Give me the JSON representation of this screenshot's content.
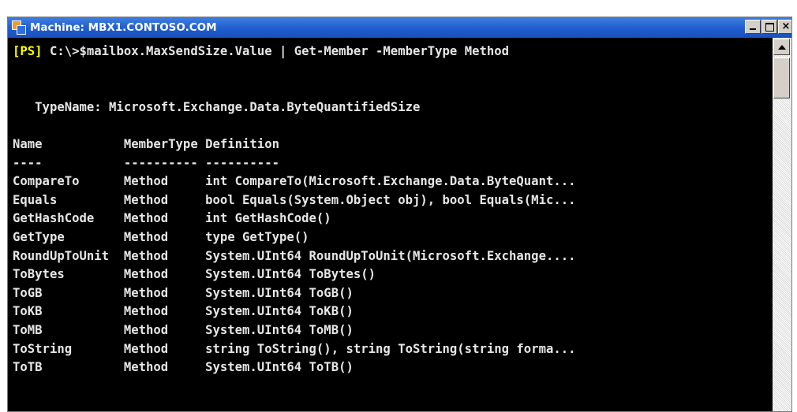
{
  "window": {
    "title": "Machine: MBX1.CONTOSO.COM",
    "close_glyph": "×"
  },
  "console": {
    "prompt": "[PS]",
    "command": " C:\\>$mailbox.MaxSendSize.Value | Get-Member -MemberType Method",
    "typename_line": "   TypeName: Microsoft.Exchange.Data.ByteQuantifiedSize",
    "header_line": "Name           MemberType Definition",
    "separator_line": "----           ---------- ----------",
    "rows": [
      "CompareTo      Method     int CompareTo(Microsoft.Exchange.Data.ByteQuant...",
      "Equals         Method     bool Equals(System.Object obj), bool Equals(Mic...",
      "GetHashCode    Method     int GetHashCode()",
      "GetType        Method     type GetType()",
      "RoundUpToUnit  Method     System.UInt64 RoundUpToUnit(Microsoft.Exchange....",
      "ToBytes        Method     System.UInt64 ToBytes()",
      "ToGB           Method     System.UInt64 ToGB()",
      "ToKB           Method     System.UInt64 ToKB()",
      "ToMB           Method     System.UInt64 ToMB()",
      "ToString       Method     string ToString(), string ToString(string forma...",
      "ToTB           Method     System.UInt64 ToTB()"
    ]
  },
  "colors": {
    "background": "#000000",
    "text": "#e6e6e6",
    "prompt": "#ffff00",
    "titlebar": "#1f5ccf"
  },
  "icons": [
    "powershell-window-icon",
    "minimize-icon",
    "maximize-icon",
    "close-icon",
    "scroll-up-arrow-icon"
  ]
}
